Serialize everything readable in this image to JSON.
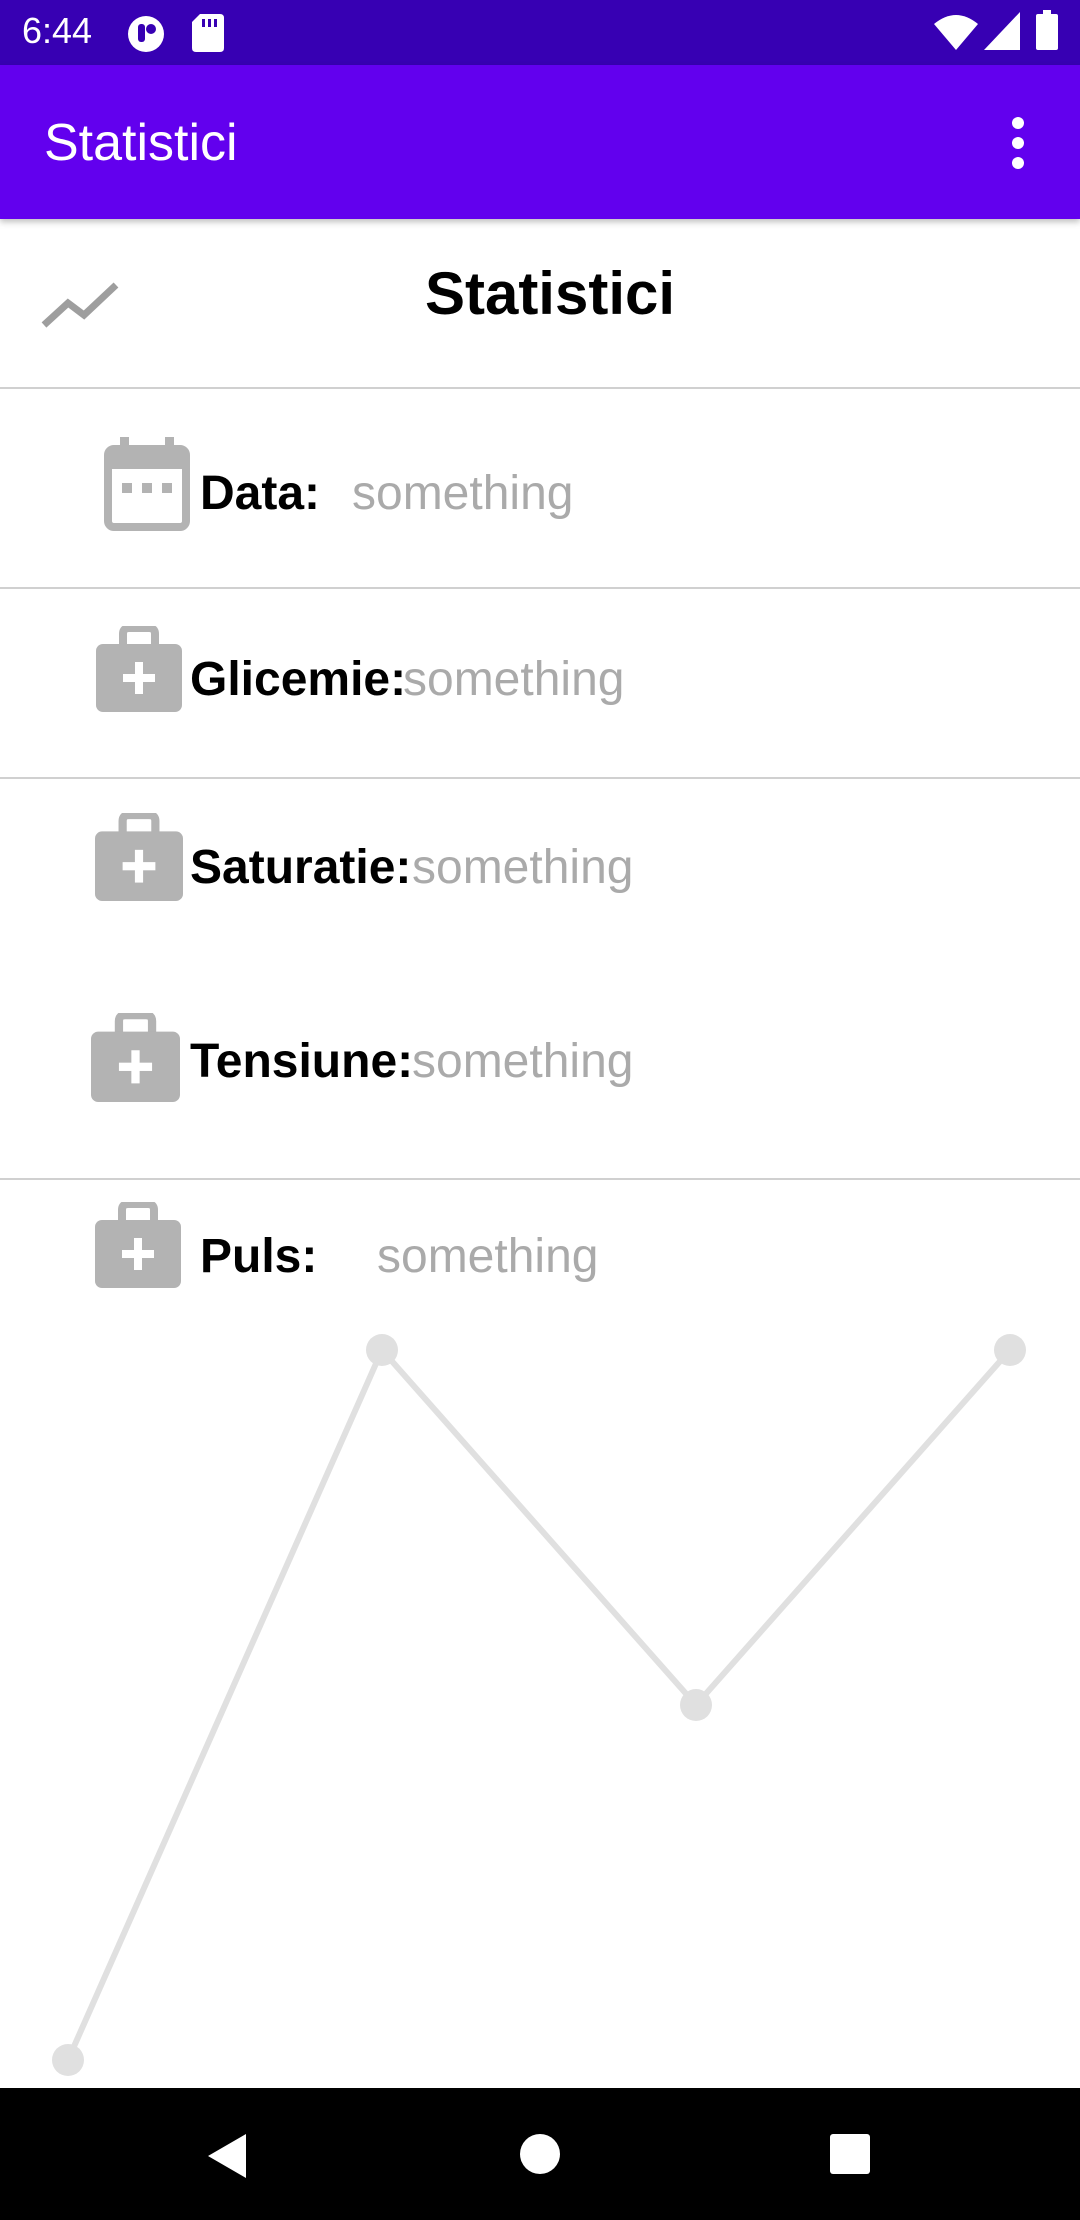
{
  "status_bar": {
    "time": "6:44",
    "icons": [
      "notification-app-icon",
      "sd-card-icon",
      "wifi-icon",
      "signal-icon",
      "battery-icon"
    ]
  },
  "app_bar": {
    "title": "Statistici",
    "overflow_icon": "more-vert-icon",
    "background": "#6200ee"
  },
  "header": {
    "icon": "trending-up-icon",
    "title": "Statistici"
  },
  "fields": [
    {
      "icon": "calendar-icon",
      "label": "Data:",
      "value": "something"
    },
    {
      "icon": "medical-bag-icon",
      "label": "Glicemie:",
      "value": "something"
    },
    {
      "icon": "medical-bag-icon",
      "label": "Saturatie:",
      "value": "something"
    },
    {
      "icon": "medical-bag-icon",
      "label": "Tensiune:",
      "value": "something"
    },
    {
      "icon": "medical-bag-icon",
      "label": "Puls:",
      "value": "something"
    }
  ],
  "chart_data": {
    "type": "line",
    "x": [
      0,
      1,
      2,
      3
    ],
    "y": [
      0,
      2,
      1,
      2
    ],
    "ylim": [
      0,
      2
    ],
    "grid": false,
    "color": "#e0e0e0"
  },
  "nav_bar": {
    "buttons": [
      "back-icon",
      "home-icon",
      "recents-icon"
    ]
  }
}
